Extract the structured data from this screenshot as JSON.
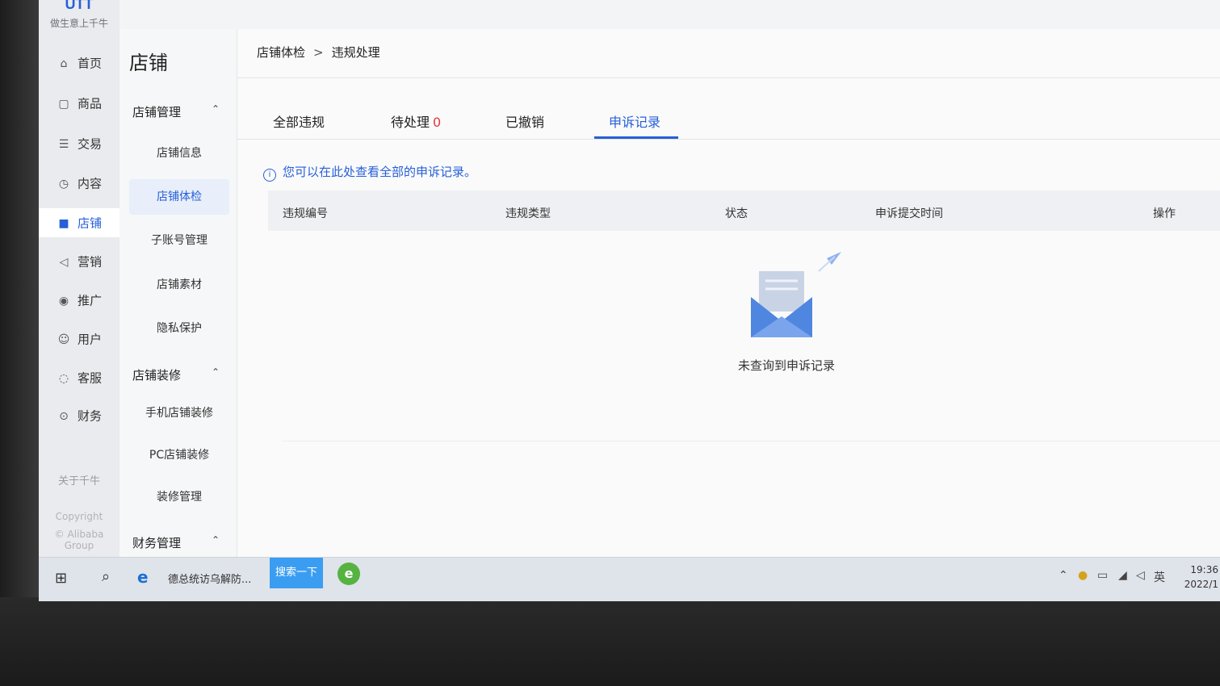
{
  "brand": {
    "logo_text": "UTT",
    "slogan": "做生意上千牛"
  },
  "primary_nav": [
    {
      "label": "首页",
      "icon": "home-icon",
      "glyph": "⌂"
    },
    {
      "label": "商品",
      "icon": "goods-icon",
      "glyph": "▢"
    },
    {
      "label": "交易",
      "icon": "trade-icon",
      "glyph": "☰"
    },
    {
      "label": "内容",
      "icon": "content-icon",
      "glyph": "◷"
    },
    {
      "label": "店铺",
      "icon": "store-icon",
      "glyph": "■",
      "active": true
    },
    {
      "label": "营销",
      "icon": "megaphone-icon",
      "glyph": "◁"
    },
    {
      "label": "推广",
      "icon": "location-pin-icon",
      "glyph": "◉"
    },
    {
      "label": "用户",
      "icon": "user-icon",
      "glyph": "☺"
    },
    {
      "label": "客服",
      "icon": "headset-icon",
      "glyph": "◌"
    },
    {
      "label": "财务",
      "icon": "finance-icon",
      "glyph": "⊙"
    }
  ],
  "about": "关于千牛",
  "copyright_line1": "Copyright",
  "copyright_line2": "© Alibaba Group",
  "secondary_nav": {
    "title": "店铺",
    "groups": [
      {
        "label": "店铺管理",
        "expanded": true,
        "items": [
          "店铺信息",
          "店铺体检",
          "子账号管理",
          "店铺素材",
          "隐私保护"
        ]
      },
      {
        "label": "店铺装修",
        "expanded": true,
        "items": [
          "手机店铺装修",
          "PC店铺装修",
          "装修管理"
        ]
      },
      {
        "label": "财务管理",
        "expanded": true,
        "items": []
      }
    ],
    "active_item": "店铺体检"
  },
  "breadcrumb": {
    "parent": "店铺体检",
    "separator": ">",
    "current": "违规处理"
  },
  "tabs": [
    {
      "label": "全部违规",
      "count": ""
    },
    {
      "label": "待处理",
      "count": "0"
    },
    {
      "label": "已撤销",
      "count": ""
    },
    {
      "label": "申诉记录",
      "count": "",
      "active": true
    }
  ],
  "notice": "您可以在此处查看全部的申诉记录。",
  "table": {
    "columns": [
      "违规编号",
      "违规类型",
      "状态",
      "申诉提交时间",
      "操作"
    ],
    "rows": []
  },
  "empty_state": {
    "icon": "empty-envelope-icon",
    "text": "未查询到申诉记录"
  },
  "taskbar": {
    "browser_task": "德总统访乌解防...",
    "search_button": "搜索一下",
    "ime": "英",
    "time": "19:36",
    "date": "2022/1"
  },
  "colors": {
    "accent": "#2760d8",
    "count_red": "#e4393c",
    "search_btn": "#3b9df2"
  }
}
